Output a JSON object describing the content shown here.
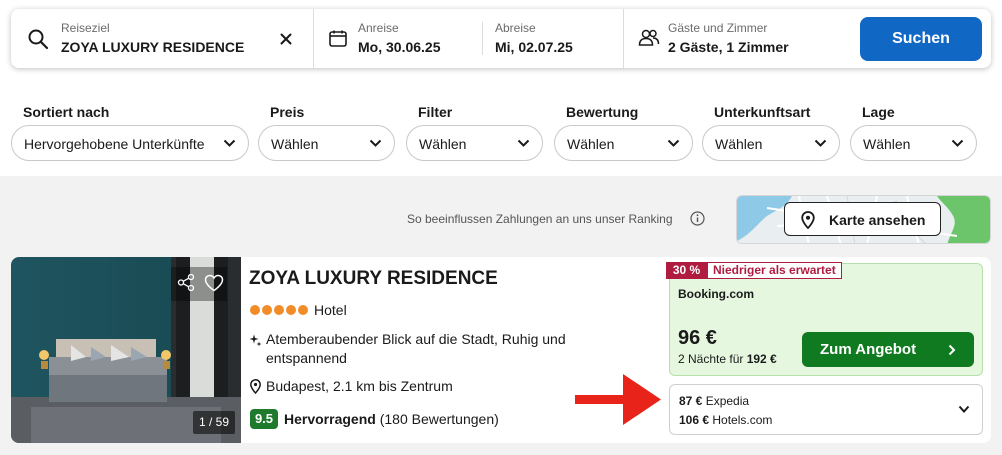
{
  "search": {
    "destination_label": "Reiseziel",
    "destination_value": "ZOYA LUXURY RESIDENCE",
    "checkin_label": "Anreise",
    "checkin_value": "Mo, 30.06.25",
    "checkout_label": "Abreise",
    "checkout_value": "Mi, 02.07.25",
    "guests_label": "Gäste und Zimmer",
    "guests_value": "2 Gäste, 1 Zimmer",
    "submit_label": "Suchen"
  },
  "filters": [
    {
      "label": "Sortiert nach",
      "value": "Hervorgehobene Unterkünfte"
    },
    {
      "label": "Preis",
      "value": "Wählen"
    },
    {
      "label": "Filter",
      "value": "Wählen"
    },
    {
      "label": "Bewertung",
      "value": "Wählen"
    },
    {
      "label": "Unterkunftsart",
      "value": "Wählen"
    },
    {
      "label": "Lage",
      "value": "Wählen"
    }
  ],
  "ranking_notice": "So beeinflussen Zahlungen an uns unser Ranking",
  "map": {
    "button_label": "Karte ansehen"
  },
  "hotel": {
    "name": "ZOYA LUXURY RESIDENCE",
    "star_count": 5,
    "type": "Hotel",
    "feature": "Atemberaubender Blick auf die Stadt, Ruhig und entspannend",
    "location": "Budapest, 2.1 km bis Zentrum",
    "rating_score": "9.5",
    "rating_word": "Hervorragend",
    "rating_count": "(180 Bewertungen)",
    "photo_counter": "1 / 59"
  },
  "deal": {
    "discount": "30 %",
    "discount_text": "Niedriger als erwartet",
    "provider": "Booking.com",
    "price": "96 €",
    "nights_prefix": "2 Nächte für ",
    "nights_total": "192 €",
    "button_label": "Zum Angebot"
  },
  "other_offers": [
    {
      "price": "87 €",
      "provider": "Expedia"
    },
    {
      "price": "106 €",
      "provider": "Hotels.com"
    }
  ],
  "colors": {
    "primary": "#1168c4",
    "offer_green": "#0f7a1f",
    "discount_red": "#b01c40",
    "rating_green": "#1e7b2e",
    "star_orange": "#f28c28",
    "annotation_red": "#e8231a"
  }
}
